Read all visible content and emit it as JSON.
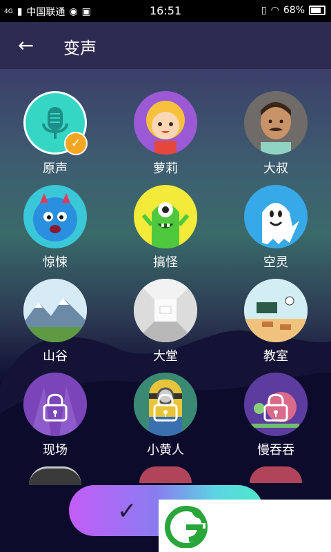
{
  "status_bar": {
    "network": "4G",
    "carrier": "中国联通",
    "time": "16:51",
    "battery": "68%"
  },
  "header": {
    "back_label": "←",
    "title": "变声"
  },
  "voices": [
    {
      "id": "original",
      "label": "原声",
      "selected": true
    },
    {
      "id": "loli",
      "label": "萝莉"
    },
    {
      "id": "uncle",
      "label": "大叔"
    },
    {
      "id": "horror",
      "label": "惊悚"
    },
    {
      "id": "funny",
      "label": "搞怪"
    },
    {
      "id": "ethereal",
      "label": "空灵"
    },
    {
      "id": "valley",
      "label": "山谷"
    },
    {
      "id": "hall",
      "label": "大堂"
    },
    {
      "id": "classroom",
      "label": "教室"
    },
    {
      "id": "live",
      "label": "现场",
      "locked": true
    },
    {
      "id": "minion",
      "label": "小黄人",
      "locked": true
    },
    {
      "id": "slow",
      "label": "慢吞吞",
      "locked": true
    }
  ],
  "confirm": {
    "check_glyph": "✓"
  },
  "selected_badge": {
    "check_glyph": "✓"
  },
  "colors": {
    "accent": "#f5a623",
    "selected_bg": "#36d6c5",
    "appbar": "#2e2b52"
  }
}
